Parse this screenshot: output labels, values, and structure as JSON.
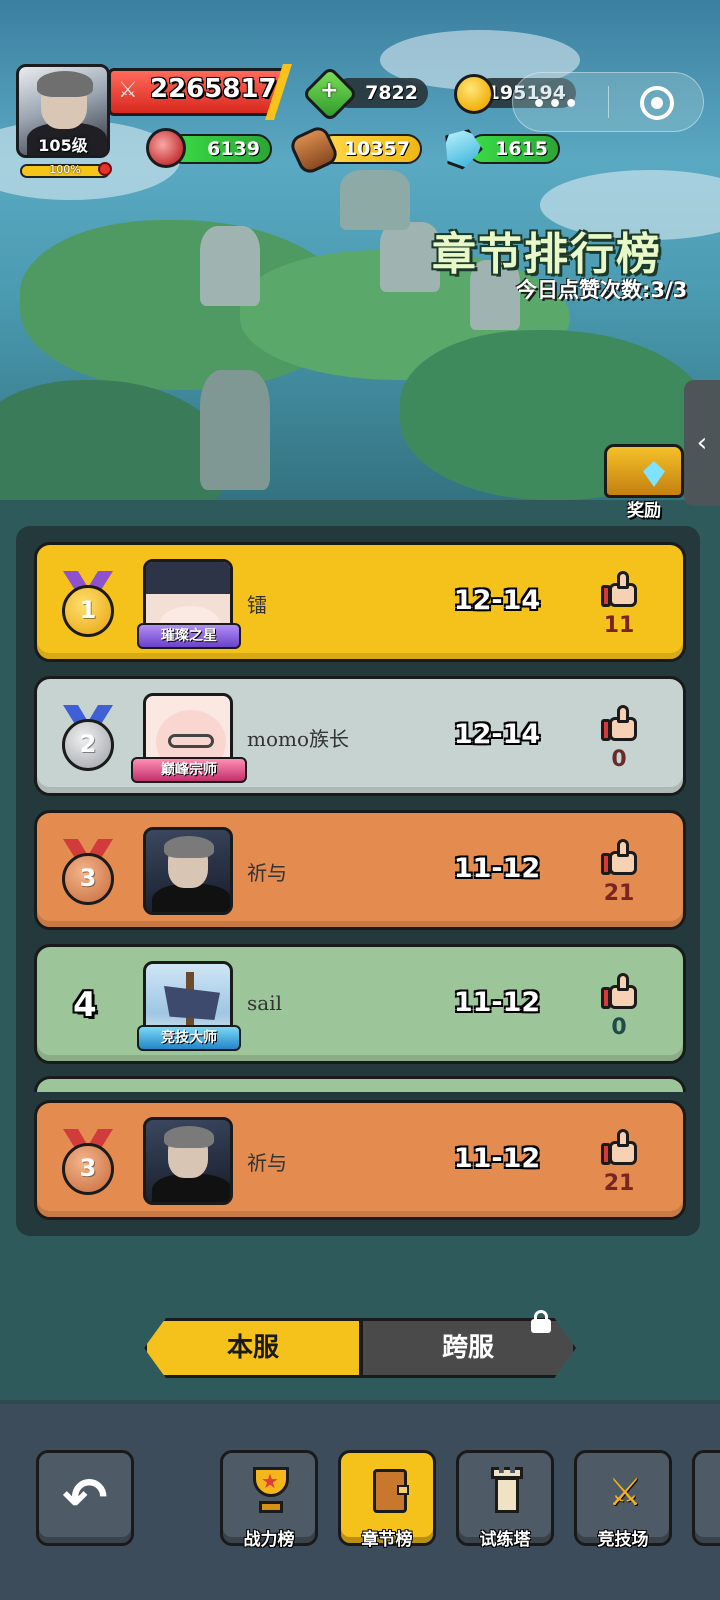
{
  "player": {
    "level": "105级",
    "exp_percent": "100%",
    "exp_fraction": 1.0,
    "power": "2265817"
  },
  "resources": {
    "gems": "7822",
    "coins": "195194",
    "meat": "6139",
    "wood": "10357",
    "crystal": "1615"
  },
  "capsule": {
    "dots": "•••"
  },
  "board": {
    "title": "章节排行榜",
    "daily_likes": "今日点赞次数:3/3",
    "reward_label": "奖励",
    "side_tab_arrow": "‹"
  },
  "rankings": [
    {
      "rank": "1",
      "medal": "gold",
      "name": "镭",
      "title": "璀璨之星",
      "chapter": "12-14",
      "likes": "11"
    },
    {
      "rank": "2",
      "medal": "silver",
      "name": "momo族长",
      "title": "巅峰宗师",
      "chapter": "12-14",
      "likes": "0"
    },
    {
      "rank": "3",
      "medal": "bronze",
      "name": "祈与",
      "title": "",
      "chapter": "11-12",
      "likes": "21"
    },
    {
      "rank": "4",
      "medal": "none",
      "name": "sail",
      "title": "竞技大师",
      "chapter": "11-12",
      "likes": "0"
    }
  ],
  "my_rank": {
    "rank": "3",
    "name": "祈与",
    "chapter": "11-12",
    "likes": "21"
  },
  "tabs": {
    "local": "本服",
    "cross": "跨服"
  },
  "nav": {
    "back": "↶",
    "items": [
      {
        "label": "战力榜",
        "icon": "trophy-icon"
      },
      {
        "label": "章节榜",
        "icon": "book-icon"
      },
      {
        "label": "试练塔",
        "icon": "tower-icon"
      },
      {
        "label": "竞技场",
        "icon": "crossed-swords-icon"
      }
    ]
  },
  "colors": {
    "gold_row": "#f5c11b",
    "silver_row": "#c7d3d0",
    "bronze_row": "#e48b4f",
    "green_row": "#9cc59a",
    "active_tab": "#f5c11b"
  }
}
